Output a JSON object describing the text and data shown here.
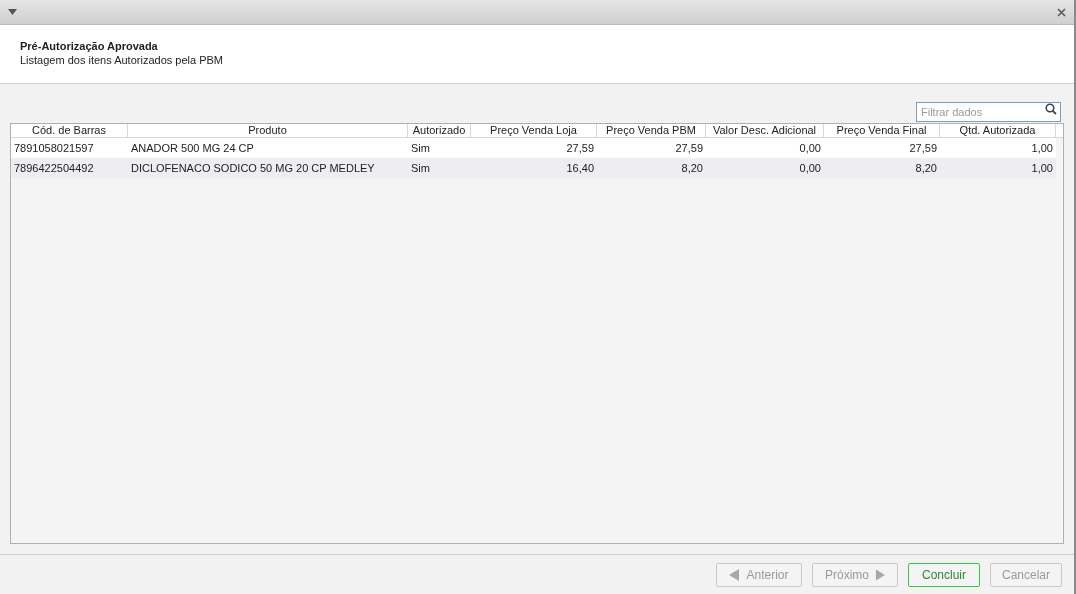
{
  "header": {
    "title": "Pré-Autorização Aprovada",
    "subtitle": "Listagem dos itens Autorizados pela PBM"
  },
  "filter": {
    "placeholder": "Filtrar dados"
  },
  "table": {
    "columns": [
      {
        "label": "Cód. de Barras",
        "numeric": false
      },
      {
        "label": "Produto",
        "numeric": false
      },
      {
        "label": "Autorizado",
        "numeric": false
      },
      {
        "label": "Preço Venda Loja",
        "numeric": true
      },
      {
        "label": "Preço Venda PBM",
        "numeric": true
      },
      {
        "label": "Valor Desc. Adicional",
        "numeric": true
      },
      {
        "label": "Preço Venda Final",
        "numeric": true
      },
      {
        "label": "Qtd. Autorizada",
        "numeric": true
      }
    ],
    "rows": [
      [
        "7891058021597",
        "ANADOR 500 MG 24 CP",
        "Sim",
        "27,59",
        "27,59",
        "0,00",
        "27,59",
        "1,00"
      ],
      [
        "7896422504492",
        "DICLOFENACO SODICO 50 MG 20 CP MEDLEY",
        "Sim",
        "16,40",
        "8,20",
        "0,00",
        "8,20",
        "1,00"
      ]
    ]
  },
  "buttons": [
    {
      "label": "Anterior",
      "kind": "prev",
      "disabled": true,
      "focused": false
    },
    {
      "label": "Próximo",
      "kind": "next",
      "disabled": true,
      "focused": false
    },
    {
      "label": "Concluir",
      "kind": "plain",
      "disabled": false,
      "focused": true
    },
    {
      "label": "Cancelar",
      "kind": "plain",
      "disabled": true,
      "focused": false
    }
  ]
}
